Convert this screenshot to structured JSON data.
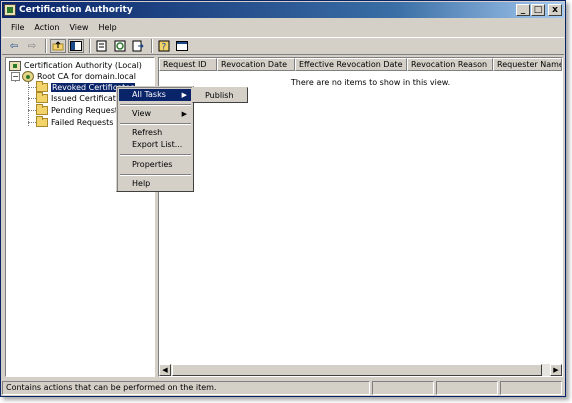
{
  "window": {
    "title": "Certification Authority",
    "controls": {
      "minimize": "_",
      "maximize": "□",
      "close": "x"
    }
  },
  "menubar": [
    "File",
    "Action",
    "View",
    "Help"
  ],
  "toolbar": {
    "icons": [
      "back-arrow-icon",
      "forward-arrow-icon",
      "up-folder-icon",
      "show-hide-tree-icon",
      "properties-icon",
      "refresh-icon",
      "export-list-icon",
      "help-icon",
      "console-tree-icon"
    ]
  },
  "tree": {
    "root": "Certification Authority (Local)",
    "ca": "Root CA for domain.local",
    "folders": [
      "Revoked Certificates",
      "Issued Certificates",
      "Pending Requests",
      "Failed Requests"
    ],
    "selected_index": 0
  },
  "list": {
    "columns": [
      "Request ID",
      "Revocation Date",
      "Effective Revocation Date",
      "Revocation Reason",
      "Requester Name"
    ],
    "empty_message": "There are no items to show in this view."
  },
  "context_menu": {
    "items": [
      "All Tasks",
      "View",
      "Refresh",
      "Export List...",
      "Properties",
      "Help"
    ],
    "highlighted": "All Tasks"
  },
  "submenu": {
    "items": [
      "Publish"
    ]
  },
  "statusbar": {
    "text": "Contains actions that can be performed on the item."
  },
  "colors": {
    "titlebar_start": "#0a246a",
    "titlebar_end": "#a6caf0",
    "selection": "#0a246a",
    "face": "#d4d0c8"
  }
}
